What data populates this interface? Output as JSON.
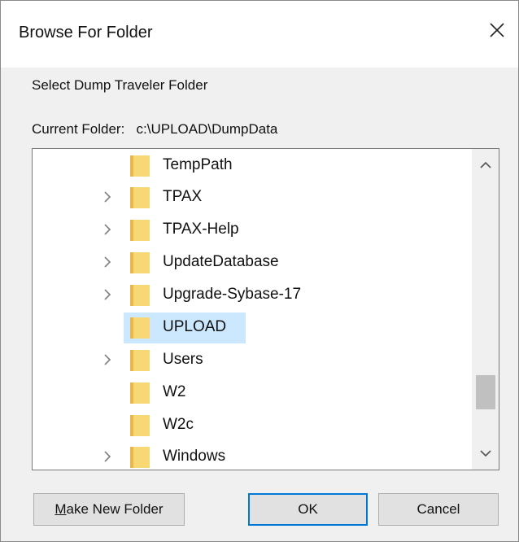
{
  "window": {
    "title": "Browse For Folder",
    "close_icon": "close-icon"
  },
  "instruction": "Select Dump Traveler Folder",
  "current_folder": {
    "label": "Current Folder:",
    "path": "c:\\UPLOAD\\DumpData"
  },
  "tree": {
    "items": [
      {
        "label": "TempPath",
        "expandable": false,
        "selected": false
      },
      {
        "label": "TPAX",
        "expandable": true,
        "selected": false
      },
      {
        "label": "TPAX-Help",
        "expandable": true,
        "selected": false
      },
      {
        "label": "UpdateDatabase",
        "expandable": true,
        "selected": false
      },
      {
        "label": "Upgrade-Sybase-17",
        "expandable": true,
        "selected": false
      },
      {
        "label": "UPLOAD",
        "expandable": false,
        "selected": true
      },
      {
        "label": "Users",
        "expandable": true,
        "selected": false
      },
      {
        "label": "W2",
        "expandable": false,
        "selected": false
      },
      {
        "label": "W2c",
        "expandable": false,
        "selected": false
      },
      {
        "label": "Windows",
        "expandable": true,
        "selected": false
      }
    ],
    "selection_color": "#cce8ff",
    "folder_color": "#f8d775"
  },
  "buttons": {
    "make_new_folder_first": "M",
    "make_new_folder_rest": "ake New Folder",
    "ok": "OK",
    "cancel": "Cancel"
  },
  "colors": {
    "accent": "#0078d7",
    "dialog_bg": "#f0f0f0"
  }
}
